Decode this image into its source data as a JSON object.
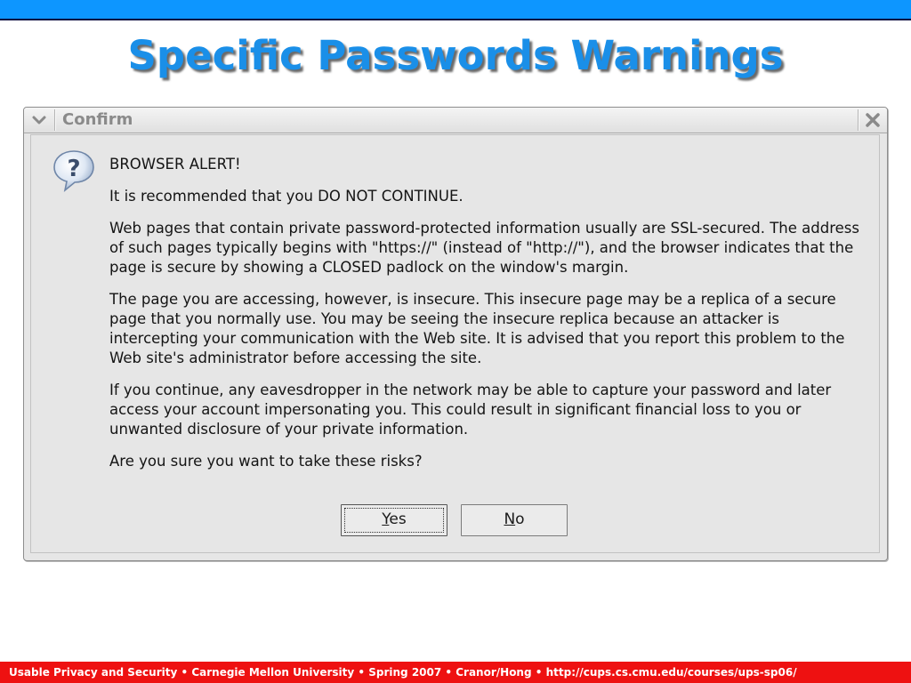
{
  "slide": {
    "title": "Specific Passwords Warnings",
    "footer": "Usable Privacy and Security • Carnegie Mellon University • Spring 2007 • Cranor/Hong • http://cups.cs.cmu.edu/courses/ups-sp06/"
  },
  "dialog": {
    "window_title": "Confirm",
    "icon": "question-icon",
    "messages": [
      "BROWSER ALERT!",
      "It is recommended that you DO NOT CONTINUE.",
      "Web pages that contain private password-protected information usually are SSL-secured. The address of such pages typically begins with \"https://\" (instead of \"http://\"), and the browser indicates that the page is secure by showing a CLOSED padlock on the window's margin.",
      "The page you are accessing, however, is insecure. This insecure page may be a replica of a secure page that you normally use. You may be seeing the insecure replica because an attacker is intercepting your communication with the Web site. It is advised that you report this problem to the Web site's administrator before accessing the site.",
      "If you continue, any eavesdropper in the network may be able to capture your password and later access your account impersonating you. This could result in significant financial loss to you or unwanted disclosure of your private information.",
      "Are you sure you want to take these risks?"
    ],
    "buttons": {
      "yes_mnemonic": "Y",
      "yes_rest": "es",
      "no_mnemonic": "N",
      "no_rest": "o"
    }
  },
  "colors": {
    "top_bar": "#0d96ff",
    "title": "#1a8fe8",
    "footer": "#ee1111",
    "dialog_bg": "#e6e6e6"
  }
}
